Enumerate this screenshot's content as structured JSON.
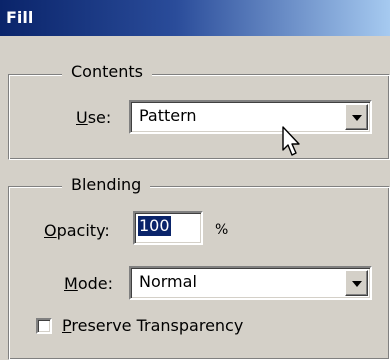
{
  "window": {
    "title": "Fill"
  },
  "contents": {
    "legend": "Contents",
    "use_label_key": "U",
    "use_label_rest": "se:",
    "use_value": "Pattern"
  },
  "blending": {
    "legend": "Blending",
    "opacity_label_key": "O",
    "opacity_label_rest": "pacity:",
    "opacity_value": "100",
    "opacity_unit": "%",
    "mode_label_key": "M",
    "mode_label_rest": "ode:",
    "mode_value": "Normal",
    "preserve_key": "P",
    "preserve_rest": "reserve Transparency",
    "preserve_checked": false
  },
  "icons": {
    "cursor": "mouse-pointer-icon",
    "dropdown": "chevron-down-icon"
  },
  "colors": {
    "titlebar_start": "#0a246a",
    "titlebar_end": "#a6caf0",
    "face": "#d4d0c8",
    "selection": "#0a246a"
  }
}
